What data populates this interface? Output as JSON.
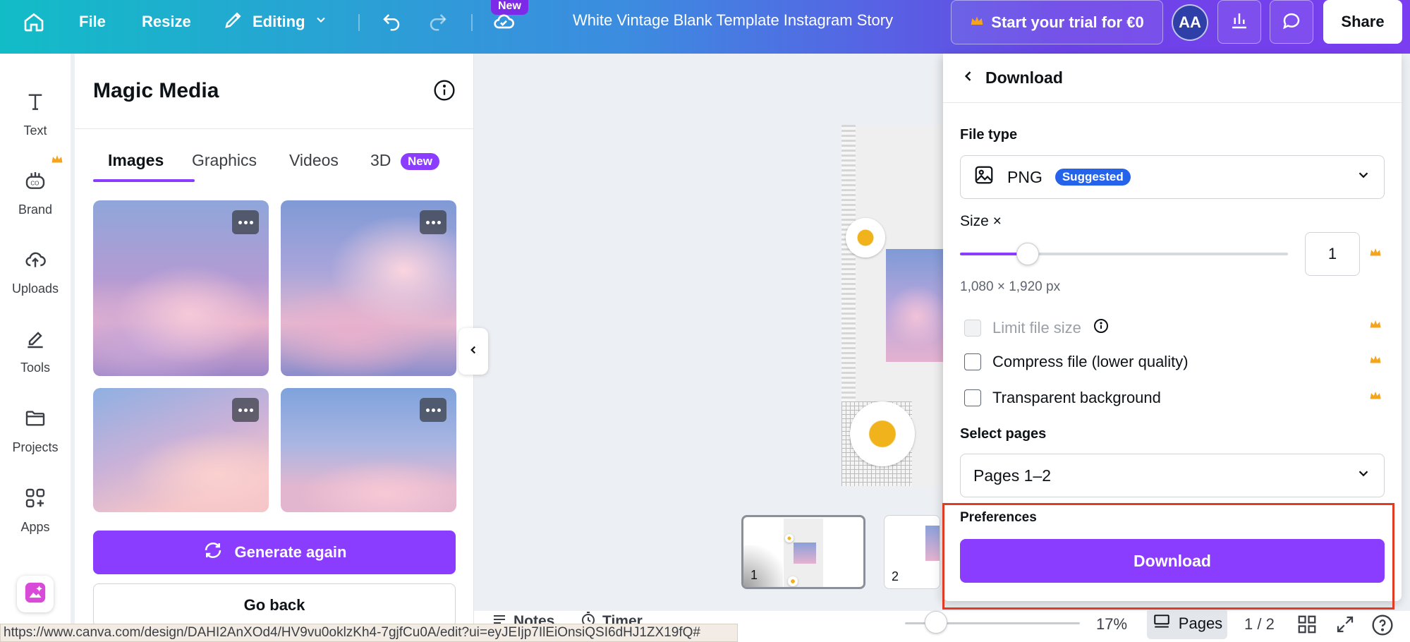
{
  "topbar": {
    "file_label": "File",
    "resize_label": "Resize",
    "editing_label": "Editing",
    "new_badge": "New",
    "doc_title": "White Vintage Blank Template Instagram Story",
    "trial_label": "Start your trial for €0",
    "avatar_initials": "AA",
    "share_label": "Share"
  },
  "rail": {
    "items": [
      {
        "label": "Text",
        "icon": "text-icon"
      },
      {
        "label": "Brand",
        "icon": "brand-icon"
      },
      {
        "label": "Uploads",
        "icon": "cloud-upload-icon"
      },
      {
        "label": "Tools",
        "icon": "pen-icon"
      },
      {
        "label": "Projects",
        "icon": "folder-icon"
      },
      {
        "label": "Apps",
        "icon": "apps-icon"
      }
    ]
  },
  "panel": {
    "title": "Magic Media",
    "tabs": [
      {
        "label": "Images",
        "active": true
      },
      {
        "label": "Graphics",
        "active": false
      },
      {
        "label": "Videos",
        "active": false
      },
      {
        "label": "3D",
        "active": false
      }
    ],
    "tab_new_badge": "New",
    "generate_again_label": "Generate again",
    "go_back_label": "Go back"
  },
  "canvas": {
    "page_thumbs": [
      {
        "number": "1"
      },
      {
        "number": "2"
      }
    ]
  },
  "bottombar": {
    "notes_label": "Notes",
    "timer_label": "Timer",
    "zoom": "17%",
    "pages_label": "Pages",
    "page_count": "1 / 2"
  },
  "statusbar": {
    "url": "https://www.canva.com/design/DAHI2AnXOd4/HV9vu0oklzKh4-7gjfCu0A/edit?ui=eyJEIjp7IlEiOnsiQSI6dHJ1ZX19fQ#"
  },
  "download": {
    "title": "Download",
    "file_type_label": "File type",
    "file_type_value": "PNG",
    "suggested_badge": "Suggested",
    "size_label": "Size ×",
    "size_value": "1",
    "size_fraction": 0.17,
    "dimensions": "1,080 × 1,920 px",
    "options": [
      {
        "label": "Limit file size",
        "checked": false,
        "disabled": true
      },
      {
        "label": "Compress file (lower quality)",
        "checked": false,
        "disabled": false
      },
      {
        "label": "Transparent background",
        "checked": false,
        "disabled": false
      }
    ],
    "select_pages_label": "Select pages",
    "pages_value": "Pages 1–2",
    "preferences_label": "Preferences",
    "download_button": "Download"
  },
  "colors": {
    "accent": "#8b3dff",
    "highlight": "#e03b24",
    "suggested": "#2563eb",
    "crown": "#f4a51c"
  }
}
